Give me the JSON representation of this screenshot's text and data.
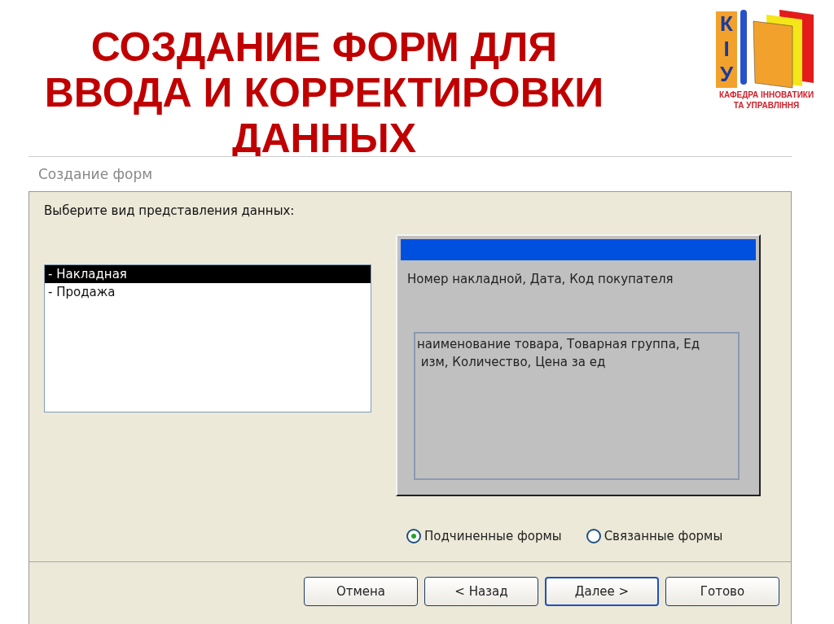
{
  "slide_title": [
    "СОЗДАНИЕ ФОРМ ДЛЯ",
    "ВВОДА И КОРРЕКТИРОВКИ",
    "ДАННЫХ"
  ],
  "logo": {
    "letters": [
      "К",
      "І",
      "У"
    ],
    "caption": [
      "КАФЕДРА ІННОВАТИКИ",
      "ТА УПРАВЛІННЯ"
    ]
  },
  "dialog": {
    "title": "Создание форм",
    "prompt": "Выберите вид представления данных:",
    "list_items": [
      {
        "label": "- Накладная",
        "selected": true
      },
      {
        "label": "- Продажа",
        "selected": false
      }
    ],
    "preview": {
      "main_fields": "Номер накладной, Дата, Код покупателя",
      "subform_fields": "наименование товара, Товарная группа, Ед\n изм, Количество, Цена за ед"
    },
    "options": [
      {
        "label": "Подчиненные формы",
        "selected": true
      },
      {
        "label": "Связанные формы",
        "selected": false
      }
    ],
    "buttons": [
      {
        "label": "Отмена",
        "default": false
      },
      {
        "label": "< Назад",
        "default": false
      },
      {
        "label": "Далее >",
        "default": true
      },
      {
        "label": "Готово",
        "default": false
      }
    ]
  }
}
